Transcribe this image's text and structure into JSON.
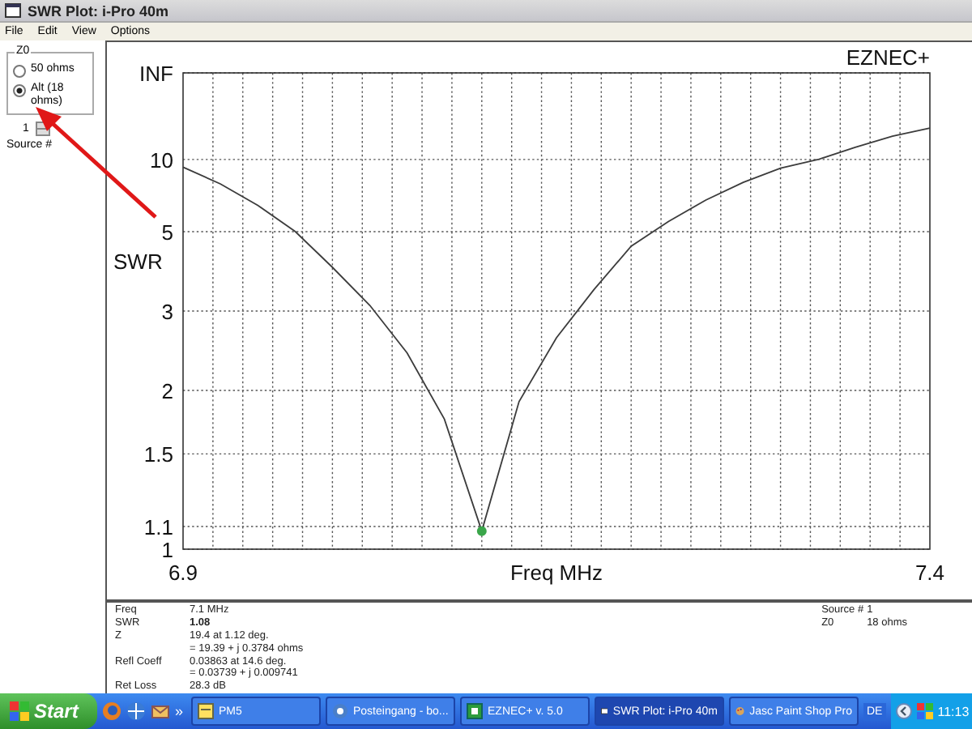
{
  "window": {
    "title": "SWR Plot: i-Pro 40m"
  },
  "menu": [
    "File",
    "Edit",
    "View",
    "Options"
  ],
  "z0_group": {
    "label": "Z0",
    "options": [
      {
        "label": "50 ohms",
        "selected": false
      },
      {
        "label": "Alt (18 ohms)",
        "selected": true
      }
    ]
  },
  "source": {
    "value": "1",
    "label": "Source #"
  },
  "plot": {
    "brand": "EZNEC+",
    "y_title": "SWR",
    "x_title": "Freq MHz",
    "y_axis_labels": [
      "INF",
      "10",
      "5",
      "3",
      "2",
      "1.5",
      "1.1",
      "1"
    ],
    "x_axis_labels": [
      "6.9",
      "7.4"
    ]
  },
  "readout": {
    "left": [
      {
        "label": "Freq",
        "values": [
          "7.1 MHz"
        ],
        "bold": false
      },
      {
        "label": "SWR",
        "values": [
          "1.08"
        ],
        "bold": true
      },
      {
        "label": "Z",
        "values": [
          "19.4 at 1.12 deg.",
          "= 19.39 + j 0.3784 ohms"
        ],
        "bold": false
      },
      {
        "label": "Refl Coeff",
        "values": [
          "0.03863 at 14.6 deg.",
          "= 0.03739 + j 0.009741"
        ],
        "bold": false
      },
      {
        "label": "Ret Loss",
        "values": [
          "28.3 dB"
        ],
        "bold": false
      }
    ],
    "right": [
      {
        "label": "Source #",
        "values": [
          "1"
        ],
        "bold": false
      },
      {
        "label": "Z0",
        "values": [
          "18 ohms"
        ],
        "bold": false
      }
    ]
  },
  "taskbar": {
    "start": "Start",
    "more": "»",
    "tasks": [
      {
        "label": "PM5",
        "kind": "note",
        "selected": false
      },
      {
        "label": "Posteingang - bo...",
        "kind": "mail",
        "selected": false
      },
      {
        "label": "EZNEC+  v. 5.0",
        "kind": "app",
        "selected": false
      },
      {
        "label": "SWR Plot: i-Pro 40m",
        "kind": "window",
        "selected": true
      },
      {
        "label": "Jasc Paint Shop Pro",
        "kind": "paint",
        "selected": false
      }
    ],
    "language": "DE",
    "clock": "11:13"
  }
}
